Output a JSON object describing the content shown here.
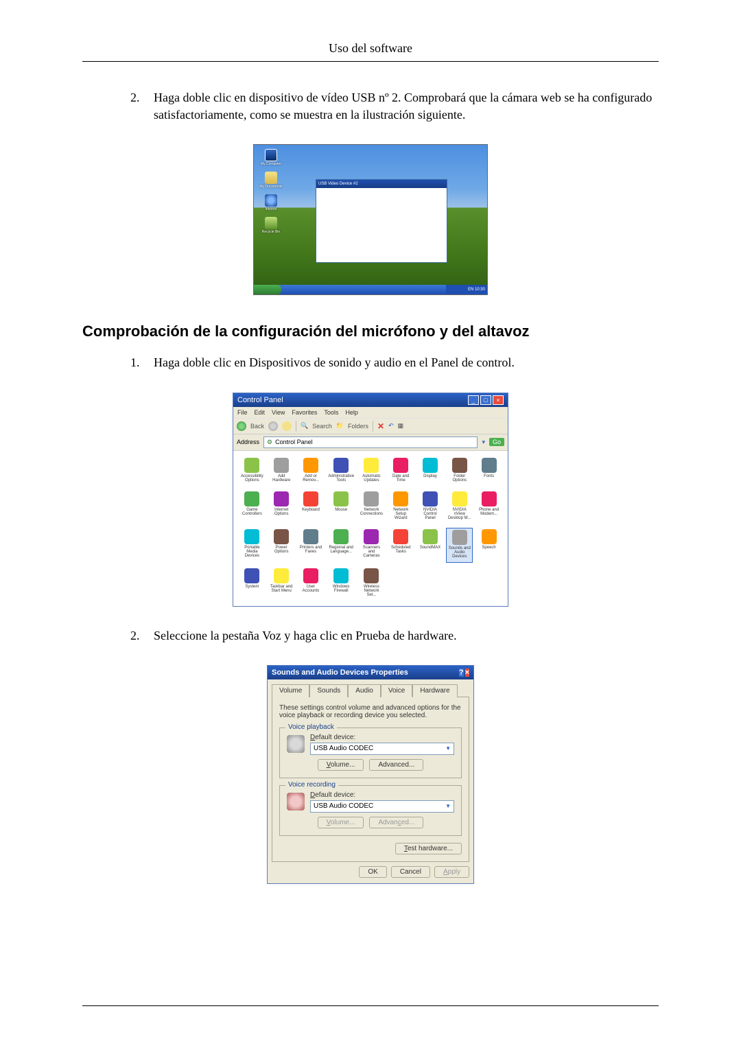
{
  "header": {
    "title": "Uso del software"
  },
  "list1": {
    "items": [
      {
        "number": "2.",
        "text": "Haga doble clic en dispositivo de vídeo USB nº 2. Comprobará que la cámara web se ha configurado satisfactoriamente, como se muestra en la ilustración siguiente."
      }
    ]
  },
  "section_heading": "Comprobación de la configuración del micrófono y del altavoz",
  "list2": {
    "items": [
      {
        "number": "1.",
        "text": "Haga doble clic en Dispositivos de sonido y audio en el Panel de control."
      }
    ]
  },
  "list3": {
    "items": [
      {
        "number": "2.",
        "text": "Seleccione la pestaña Voz y haga clic en Prueba de hardware."
      }
    ]
  },
  "xp_desktop": {
    "tray_text": "EN 10:30",
    "icons": [
      "My Computer",
      "My Documents",
      "Internet",
      "Recycle Bin"
    ],
    "window_title": "USB Video Device #2"
  },
  "control_panel": {
    "title": "Control Panel",
    "menu": [
      "File",
      "Edit",
      "View",
      "Favorites",
      "Tools",
      "Help"
    ],
    "toolbar": {
      "back": "Back",
      "search": "Search",
      "folders": "Folders"
    },
    "address_label": "Address",
    "address_value": "Control Panel",
    "go": "Go",
    "items": [
      "Accessibility Options",
      "Add Hardware",
      "Add or Remov...",
      "Administrative Tools",
      "Automatic Updates",
      "Date and Time",
      "Display",
      "Folder Options",
      "Fonts",
      "Game Controllers",
      "Internet Options",
      "Keyboard",
      "Mouse",
      "Network Connections",
      "Network Setup Wizard",
      "NVIDIA Control Panel",
      "NVIDIA nView Desktop M...",
      "Phone and Modem...",
      "Portable Media Devices",
      "Power Options",
      "Printers and Faxes",
      "Regional and Language...",
      "Scanners and Cameras",
      "Scheduled Tasks",
      "SoundMAX",
      "Sounds and Audio Devices",
      "Speech",
      "System",
      "Taskbar and Start Menu",
      "User Accounts",
      "Windows Firewall",
      "Wireless Network Set..."
    ],
    "highlight_index": 25
  },
  "sad": {
    "title": "Sounds and Audio Devices Properties",
    "tabs": [
      "Volume",
      "Sounds",
      "Audio",
      "Voice",
      "Hardware"
    ],
    "active_tab": "Voice",
    "desc": "These settings control volume and advanced options for the voice playback or recording device you selected.",
    "playback": {
      "group": "Voice playback",
      "label_prefix": "D",
      "label_rest": "efault device:",
      "value": "USB Audio CODEC",
      "volume_prefix": "V",
      "volume_rest": "olume...",
      "advanced_prefix": "",
      "advanced_text": "Advanced..."
    },
    "recording": {
      "group": "Voice recording",
      "label_prefix": "D",
      "label_rest": "efault device:",
      "value": "USB Audio CODEC",
      "volume_prefix": "V",
      "volume_rest": "olume...",
      "advanced_prefix": "Advan",
      "advanced_underline": "c",
      "advanced_suffix": "ed..."
    },
    "test_prefix": "T",
    "test_rest": "est hardware...",
    "footer": {
      "ok": "OK",
      "cancel": "Cancel",
      "apply_prefix": "A",
      "apply_rest": "pply"
    }
  }
}
